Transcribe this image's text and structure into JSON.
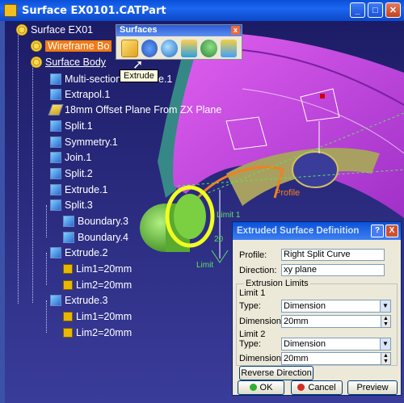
{
  "window": {
    "title": "Surface EX0101.CATPart",
    "min": "_",
    "max": "□",
    "close": "✕"
  },
  "tree": {
    "nodes": [
      {
        "label": "Surface EX01",
        "icon": "part-gear-icon"
      },
      {
        "label": "Wireframe Bo",
        "icon": "geometric-set-icon"
      },
      {
        "label": "Surface Body",
        "icon": "geometric-set-icon"
      },
      {
        "label": "Multi-sections Surface.1",
        "icon": "multi-sections-icon"
      },
      {
        "label": "Extrapol.1",
        "icon": "extrapolate-icon"
      },
      {
        "label": "18mm Offset Plane From ZX Plane",
        "icon": "plane-icon"
      },
      {
        "label": "Split.1",
        "icon": "split-icon"
      },
      {
        "label": "Symmetry.1",
        "icon": "symmetry-icon"
      },
      {
        "label": "Join.1",
        "icon": "join-icon"
      },
      {
        "label": "Split.2",
        "icon": "split-icon"
      },
      {
        "label": "Extrude.1",
        "icon": "extrude-icon"
      },
      {
        "label": "Split.3",
        "icon": "split-icon"
      },
      {
        "label": "Boundary.3",
        "icon": "boundary-icon"
      },
      {
        "label": "Boundary.4",
        "icon": "boundary-icon"
      },
      {
        "label": "Extrude.2",
        "icon": "extrude-icon"
      },
      {
        "label": "Lim1=20mm",
        "icon": "limit-icon"
      },
      {
        "label": "Lim2=20mm",
        "icon": "limit-icon"
      },
      {
        "label": "Extrude.3",
        "icon": "extrude-icon"
      },
      {
        "label": "Lim1=20mm",
        "icon": "limit-icon"
      },
      {
        "label": "Lim2=20mm",
        "icon": "limit-icon"
      }
    ]
  },
  "toolbar": {
    "title": "Surfaces",
    "close": "x",
    "tooltip": "Extrude"
  },
  "viewport": {
    "label_profile": "Profile",
    "label_limit": "Limit 1",
    "label_limit2": "Limit",
    "dim_20": "20"
  },
  "dialog": {
    "title": "Extruded Surface Definition",
    "help": "?",
    "close": "X",
    "profile_label": "Profile:",
    "profile_value": "Right Split Curve",
    "direction_label": "Direction:",
    "direction_value": "xy plane",
    "limits_group": "Extrusion Limits",
    "limit1_title": "Limit 1",
    "limit1_type_label": "Type:",
    "limit1_type_value": "Dimension",
    "limit1_dim_label": "Dimension:",
    "limit1_dim_value": "20mm",
    "limit2_title": "Limit 2",
    "limit2_type_label": "Type:",
    "limit2_type_value": "Dimension",
    "limit2_dim_label": "Dimension:",
    "limit2_dim_value": "20mm",
    "reverse_button": "Reverse Direction",
    "ok_button": "OK",
    "cancel_button": "Cancel",
    "preview_button": "Preview"
  }
}
